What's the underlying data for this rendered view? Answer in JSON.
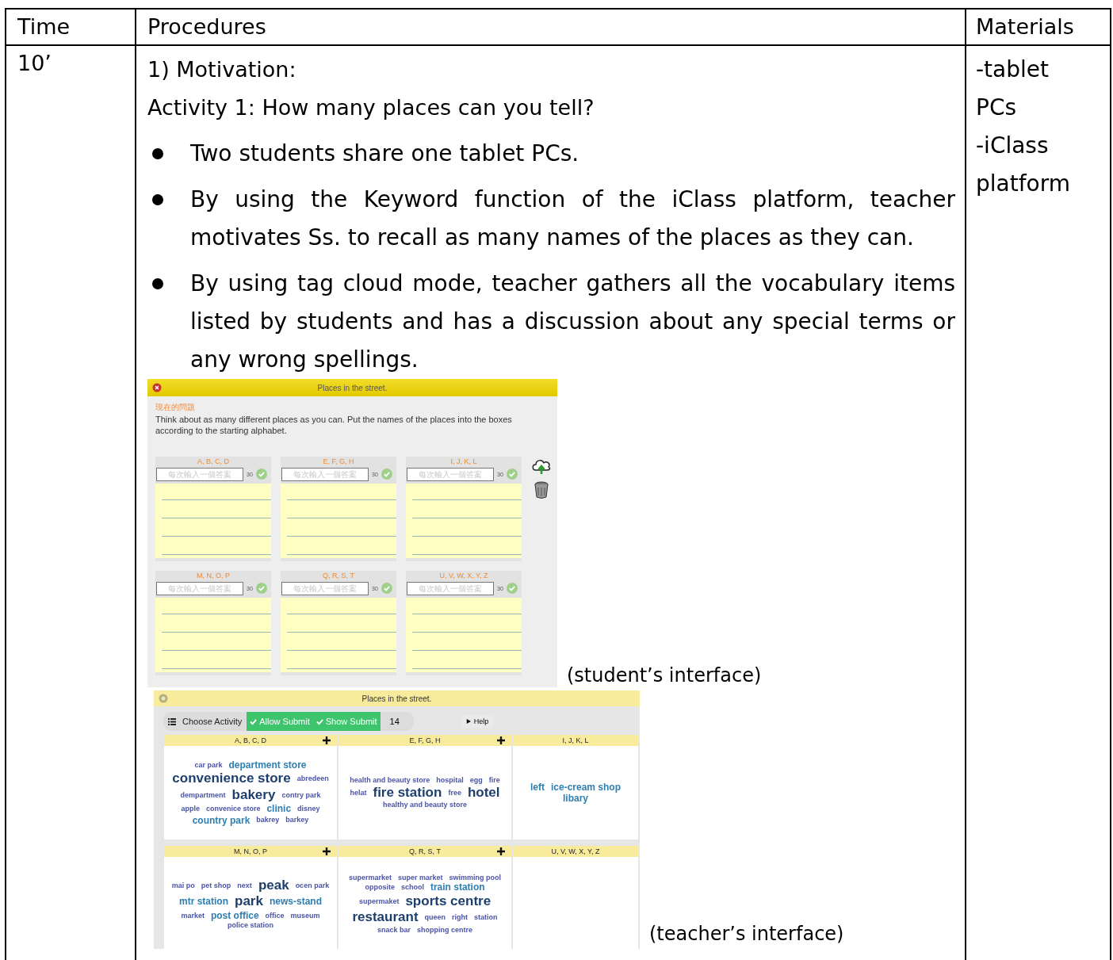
{
  "table": {
    "columns": [
      "Time",
      "Procedures",
      "Materials"
    ],
    "row": {
      "time": "10’",
      "procedures": {
        "step": "1)  Motivation:",
        "activity": "Activity 1: How many places can you tell?",
        "bullets": [
          "Two students share one tablet PCs.",
          "By using the Keyword function of the iClass platform, teacher motivates Ss. to recall as many names of the places as they can.",
          "By using tag cloud mode, teacher gathers all the vocabulary items listed by students and has a discussion about any special terms or any wrong spellings."
        ],
        "student_screen": {
          "title": "Places in the street.",
          "question_label": "現在的問題",
          "question": "Think about as many different places as you can. Put the names of the places into the boxes according to the starting alphabet.",
          "categories": [
            {
              "label": "A, B, C, D",
              "placeholder": "每次輸入一個答案",
              "count": "30"
            },
            {
              "label": "E, F, G, H",
              "placeholder": "每次輸入一個答案",
              "count": "30"
            },
            {
              "label": "I, J, K, L",
              "placeholder": "每次輸入一個答案",
              "count": "30"
            },
            {
              "label": "M, N, O, P",
              "placeholder": "每次輸入一個答案",
              "count": "30"
            },
            {
              "label": "Q, R, S, T",
              "placeholder": "每次輸入一個答案",
              "count": "30"
            },
            {
              "label": "U, V, W, X, Y, Z",
              "placeholder": "每次輸入一個答案",
              "count": "30"
            }
          ]
        },
        "student_caption": "(student’s interface)",
        "teacher_screen": {
          "title": "Places in the street.",
          "toolbar": {
            "choose": "Choose Activity",
            "allow": "Allow Submit",
            "show": "Show Submit",
            "count": "14",
            "help": "Help"
          },
          "columns": [
            {
              "label": "A, B, C, D",
              "has_add": true,
              "tags": [
                {
                  "text": "car park",
                  "kind": "small"
                },
                {
                  "text": "department store",
                  "kind": "mid"
                },
                {
                  "text": "convenience store",
                  "kind": "big"
                },
                {
                  "text": "abredeen",
                  "kind": "small"
                },
                {
                  "text": "dempartment",
                  "kind": "small"
                },
                {
                  "text": "bakery",
                  "kind": "big"
                },
                {
                  "text": "contry park",
                  "kind": "small"
                },
                {
                  "text": "apple",
                  "kind": "small"
                },
                {
                  "text": "convenice store",
                  "kind": "small"
                },
                {
                  "text": "clinic",
                  "kind": "mid"
                },
                {
                  "text": "disney",
                  "kind": "small"
                },
                {
                  "text": "country park",
                  "kind": "mid"
                },
                {
                  "text": "bakrey",
                  "kind": "small"
                },
                {
                  "text": "barkey",
                  "kind": "small"
                }
              ]
            },
            {
              "label": "E, F, G, H",
              "has_add": true,
              "tags": [
                {
                  "text": "health and beauty store",
                  "kind": "small"
                },
                {
                  "text": "hospital",
                  "kind": "small"
                },
                {
                  "text": "egg",
                  "kind": "small"
                },
                {
                  "text": "fire",
                  "kind": "small"
                },
                {
                  "text": "helat",
                  "kind": "small"
                },
                {
                  "text": "fire station",
                  "kind": "big"
                },
                {
                  "text": "free",
                  "kind": "small"
                },
                {
                  "text": "hotel",
                  "kind": "big"
                },
                {
                  "text": "healthy and beauty store",
                  "kind": "small"
                }
              ]
            },
            {
              "label": "I, J, K, L",
              "tags": [
                {
                  "text": "left",
                  "kind": "mid"
                },
                {
                  "text": "ice-cream shop",
                  "kind": "mid"
                },
                {
                  "text": "libary",
                  "kind": "mid"
                }
              ]
            },
            {
              "label": "M, N, O, P",
              "has_add": true,
              "tags": [
                {
                  "text": "mai po",
                  "kind": "small"
                },
                {
                  "text": "pet shop",
                  "kind": "small"
                },
                {
                  "text": "next",
                  "kind": "small"
                },
                {
                  "text": "peak",
                  "kind": "big"
                },
                {
                  "text": "ocen park",
                  "kind": "small"
                },
                {
                  "text": "mtr station",
                  "kind": "mid"
                },
                {
                  "text": "park",
                  "kind": "big"
                },
                {
                  "text": "news-stand",
                  "kind": "mid"
                },
                {
                  "text": "market",
                  "kind": "small"
                },
                {
                  "text": "post office",
                  "kind": "mid"
                },
                {
                  "text": "office",
                  "kind": "small"
                },
                {
                  "text": "museum",
                  "kind": "small"
                },
                {
                  "text": "police station",
                  "kind": "small"
                }
              ]
            },
            {
              "label": "Q, R, S, T",
              "has_add": true,
              "tags": [
                {
                  "text": "supermarket",
                  "kind": "small"
                },
                {
                  "text": "super market",
                  "kind": "small"
                },
                {
                  "text": "swimming pool",
                  "kind": "small"
                },
                {
                  "text": "opposite",
                  "kind": "small"
                },
                {
                  "text": "school",
                  "kind": "small"
                },
                {
                  "text": "train station",
                  "kind": "mid"
                },
                {
                  "text": "supermaket",
                  "kind": "small"
                },
                {
                  "text": "sports centre",
                  "kind": "big"
                },
                {
                  "text": "restaurant",
                  "kind": "big"
                },
                {
                  "text": "queen",
                  "kind": "small"
                },
                {
                  "text": "right",
                  "kind": "small"
                },
                {
                  "text": "station",
                  "kind": "small"
                },
                {
                  "text": "snack bar",
                  "kind": "small"
                },
                {
                  "text": "shopping centre",
                  "kind": "small"
                }
              ]
            },
            {
              "label": "U, V, W, X, Y, Z"
            }
          ]
        },
        "teacher_caption": "(teacher’s interface)"
      },
      "materials": [
        "-tablet PCs",
        "-iClass platform"
      ]
    }
  }
}
